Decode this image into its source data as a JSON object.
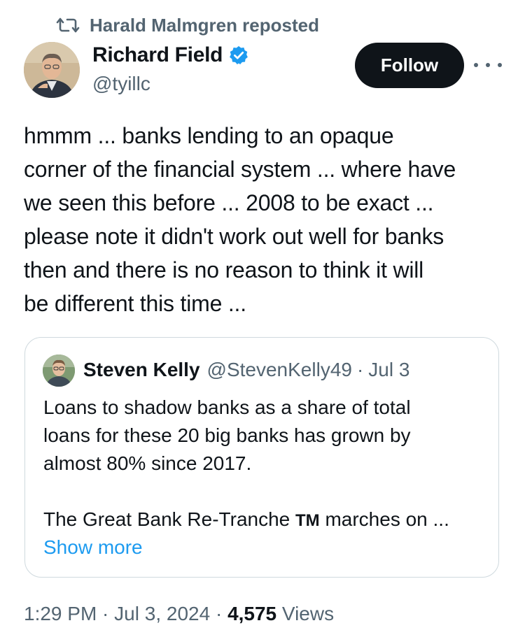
{
  "repost": {
    "icon": "repost-icon",
    "text": "Harald Malmgren reposted"
  },
  "author": {
    "name": "Richard Field",
    "handle": "@tyillc",
    "verified": true,
    "verified_color": "#1d9bf0"
  },
  "actions": {
    "follow_label": "Follow",
    "more_icon": "more-icon"
  },
  "tweet": {
    "text": "hmmm ... banks lending to an opaque\ncorner of the financial system ... where have\nwe seen this before ... 2008 to be exact ...\nplease note it didn't work out well for banks\nthen and there is no reason to think it will\nbe different this time ..."
  },
  "quote": {
    "name": "Steven Kelly",
    "handle": "@StevenKelly49",
    "separator": "·",
    "date": "Jul 3",
    "text": "Loans to shadow banks as a share of total\nloans for these 20 big banks has grown by\nalmost 80% since 2017.",
    "text2_before": "The Great Bank Re-Tranche ",
    "text2_tm": "TM",
    "text2_after": " marches on ...",
    "show_more": "Show more"
  },
  "meta": {
    "time": "1:29 PM",
    "sep1": " · ",
    "date": "Jul 3, 2024",
    "sep2": " · ",
    "views_count": "4,575",
    "views_label": " Views"
  },
  "colors": {
    "text": "#0f1419",
    "secondary": "#536471",
    "link": "#1d9bf0",
    "border": "#cfd9de",
    "button_bg": "#0f1419"
  }
}
